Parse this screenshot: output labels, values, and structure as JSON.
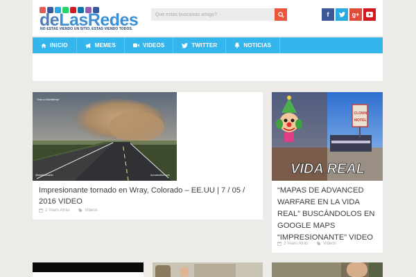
{
  "header": {
    "logo": {
      "text_part1": "de",
      "text_part2": "LasRedes",
      "tagline": "NO ESTAS VIENDO UN SITIO, ESTAS VIENDO TODOS."
    },
    "search": {
      "placeholder": "Que estas buscando amigo?",
      "button_icon": "search-icon"
    },
    "social": [
      {
        "name": "facebook",
        "glyph": "f",
        "color": "#3b5998"
      },
      {
        "name": "twitter",
        "glyph": "t",
        "color": "#29aae1"
      },
      {
        "name": "google-plus",
        "glyph": "g+",
        "color": "#dd4b39"
      },
      {
        "name": "youtube",
        "glyph": "▶",
        "color": "#d4181f"
      }
    ]
  },
  "nav": {
    "items": [
      {
        "label": "INICIO",
        "icon": "home-icon"
      },
      {
        "label": "MEMES",
        "icon": "megaphone-icon"
      },
      {
        "label": "VIDEOS",
        "icon": "video-camera-icon"
      },
      {
        "label": "TWITTER",
        "icon": "twitter-icon"
      },
      {
        "label": "NOTICIAS",
        "icon": "bell-icon"
      }
    ]
  },
  "posts": [
    {
      "title": "Impresionante tornado en Wray, Colorado – EE.UU | 7 / 05 / 2016 VIDEO",
      "time": "2 Years Atrás",
      "category": "Videos",
      "thumb_overlay": {
        "top_left": "Time on Worldttempt",
        "bottom_left": "@stadltonmartin",
        "bottom_right": "Accuweather.com"
      }
    },
    {
      "title": "“MAPAS DE ADVANCED WARFARE EN LA VIDA REAL” BUSCÁNDOLOS EN GOOGLE MAPS “IMPRESIONANTE” VIDEO",
      "time": "2 Years Atrás",
      "category": "Videos",
      "thumb_overlay": {
        "headline": "VIDA REAL",
        "sign_top": "CLOWN",
        "sign_bottom": "MOTEL"
      }
    }
  ],
  "colors": {
    "accent": "#34b6ec",
    "search_button": "#e9573f",
    "background": "#ecebe8"
  }
}
